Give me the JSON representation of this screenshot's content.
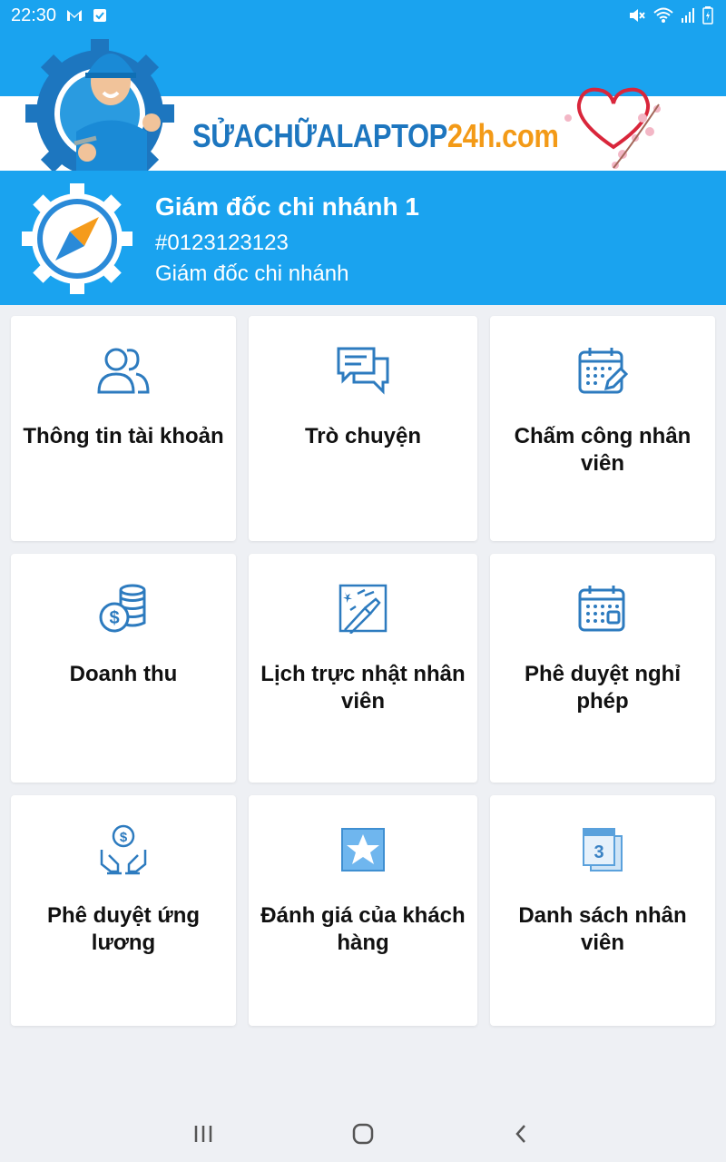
{
  "status": {
    "time": "22:30",
    "left_icons": [
      "gmail-icon",
      "checkbox-icon"
    ],
    "right_icons": [
      "mute-icon",
      "wifi-icon",
      "signal-icon",
      "battery-icon"
    ]
  },
  "banner": {
    "brand_part1": "SỬACHỮALAPTOP",
    "brand_part2": "24h.com",
    "accent_blue": "#1d76bf",
    "accent_orange": "#f39a17"
  },
  "profile": {
    "name": "Giám đốc chi nhánh 1",
    "id": "#0123123123",
    "role": "Giám đốc chi nhánh"
  },
  "menu": [
    {
      "label": "Thông tin tài khoản",
      "icon": "users-icon"
    },
    {
      "label": "Trò chuyện",
      "icon": "chat-icon"
    },
    {
      "label": "Chấm công nhân viên",
      "icon": "calendar-edit-icon"
    },
    {
      "label": "Doanh thu",
      "icon": "coins-icon"
    },
    {
      "label": "Lịch trực nhật nhân viên",
      "icon": "cleaning-icon"
    },
    {
      "label": "Phê duyệt nghỉ phép",
      "icon": "calendar-icon"
    },
    {
      "label": "Phê duyệt ứng lương",
      "icon": "salary-hands-icon"
    },
    {
      "label": "Đánh giá của khách hàng",
      "icon": "star-icon"
    },
    {
      "label": "Danh sách nhân viên",
      "icon": "list-icon"
    }
  ],
  "theme": {
    "primary": "#1aa3ef",
    "icon_color": "#2d7bbf"
  },
  "navbar": [
    "recent-apps-icon",
    "home-icon",
    "back-icon"
  ]
}
